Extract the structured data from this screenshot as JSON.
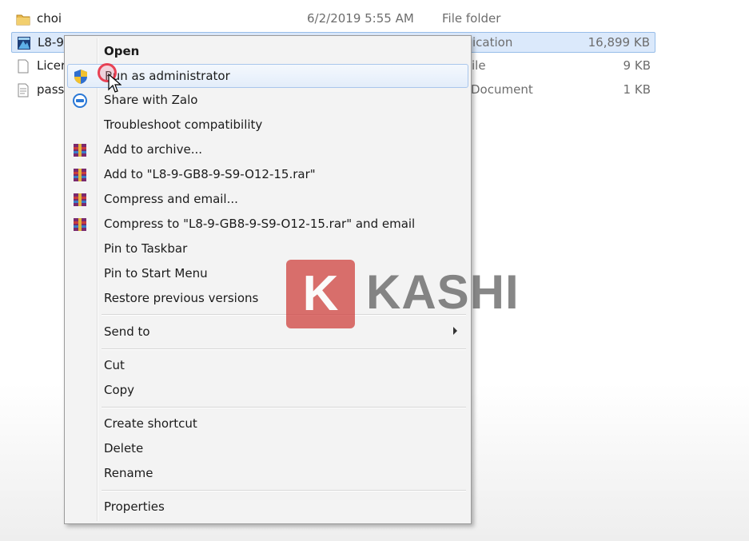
{
  "files": [
    {
      "name": "choi",
      "date": "6/2/2019 5:55 AM",
      "type": "File folder",
      "size": "",
      "icon": "folder-icon"
    },
    {
      "name": "L8-9",
      "date": "",
      "type": "ication",
      "size": "16,899 KB",
      "icon": "application-icon"
    },
    {
      "name": "Licer",
      "date": "",
      "type": "ile",
      "size": "9 KB",
      "icon": "text-file-icon"
    },
    {
      "name": "pass",
      "date": "",
      "type": "Document",
      "size": "1 KB",
      "icon": "document-icon"
    }
  ],
  "context_menu": {
    "items": [
      {
        "label": "Open",
        "bold": true
      },
      {
        "label": "Run as administrator",
        "icon": "uac-shield-icon",
        "highlighted": true
      },
      {
        "label": "Share with Zalo",
        "icon": "zalo-icon"
      },
      {
        "label": "Troubleshoot compatibility"
      },
      {
        "label": "Add to archive...",
        "icon": "winrar-icon"
      },
      {
        "label": "Add to \"L8-9-GB8-9-S9-O12-15.rar\"",
        "icon": "winrar-icon"
      },
      {
        "label": "Compress and email...",
        "icon": "winrar-icon"
      },
      {
        "label": "Compress to \"L8-9-GB8-9-S9-O12-15.rar\" and email",
        "icon": "winrar-icon"
      },
      {
        "label": "Pin to Taskbar"
      },
      {
        "label": "Pin to Start Menu"
      },
      {
        "label": "Restore previous versions"
      },
      {
        "label": "Send to",
        "submenu": true
      },
      {
        "label": "Cut"
      },
      {
        "label": "Copy"
      },
      {
        "label": "Create shortcut"
      },
      {
        "label": "Delete"
      },
      {
        "label": "Rename"
      },
      {
        "label": "Properties"
      }
    ]
  },
  "watermark": {
    "badge": "K",
    "text": "KASHI",
    "badge_color": "#cf3b38"
  },
  "colors": {
    "selection": "#dbe9fb",
    "hover_border": "#a9c6ec",
    "menu_bg": "#f3f3f3"
  }
}
